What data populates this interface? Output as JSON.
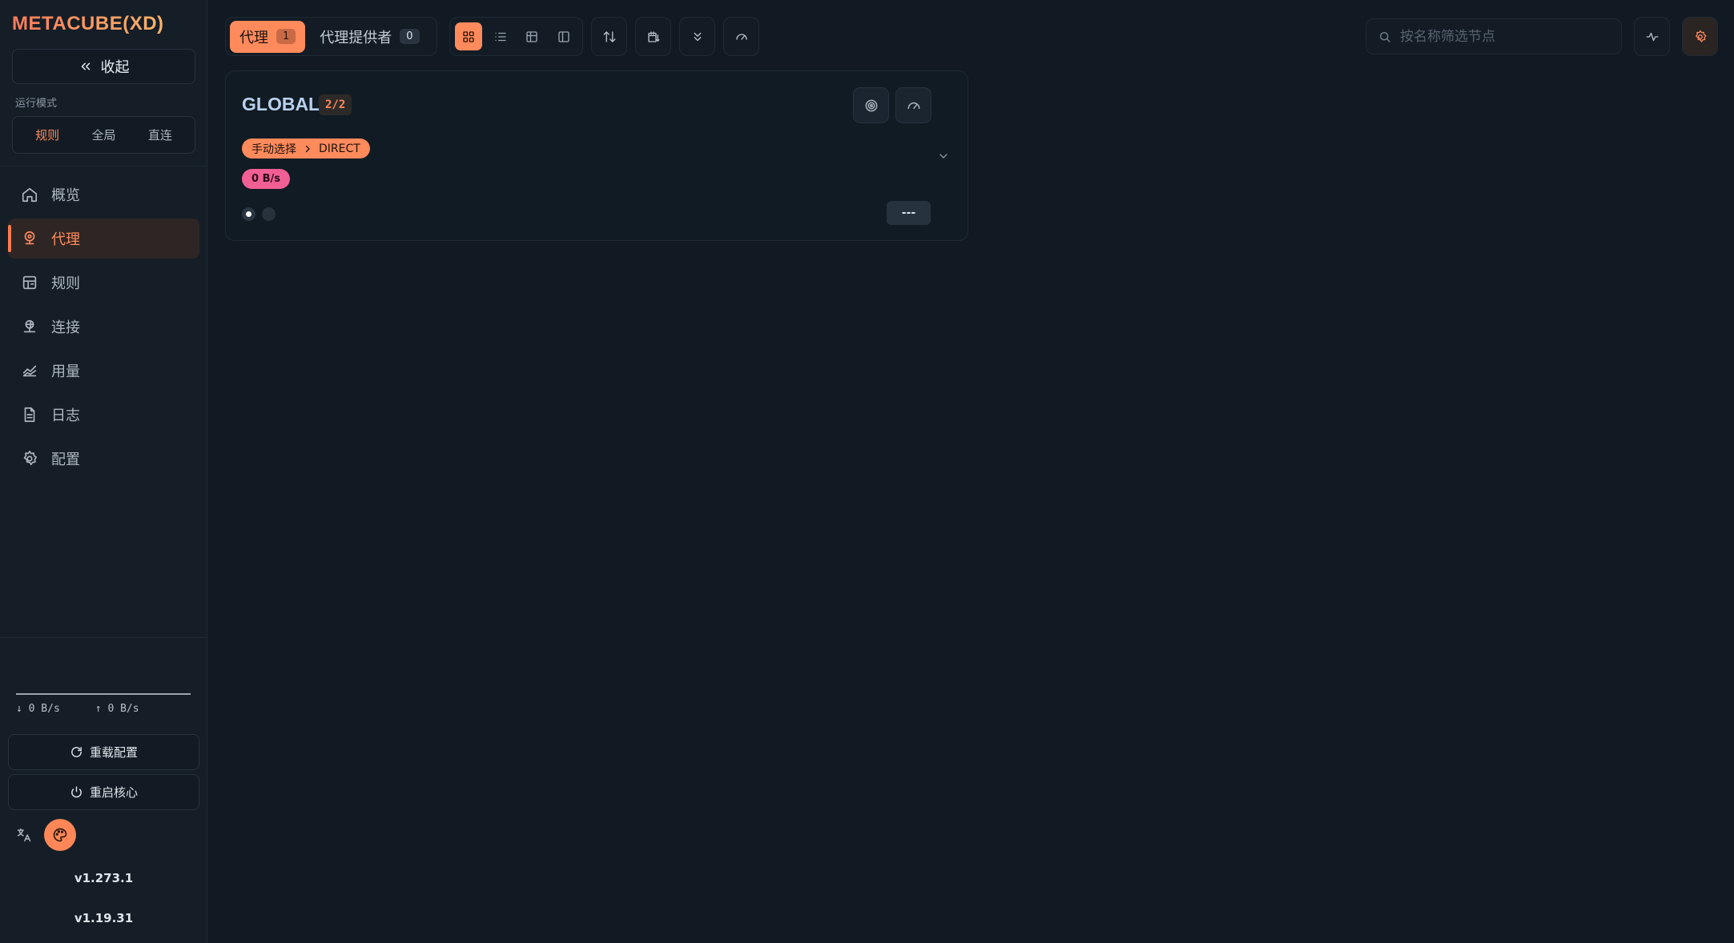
{
  "brand": "METACUBE(XD)",
  "sidebar": {
    "collapse_label": "收起",
    "mode_label": "运行模式",
    "modes": [
      {
        "label": "规则",
        "active": true
      },
      {
        "label": "全局",
        "active": false
      },
      {
        "label": "直连",
        "active": false
      }
    ],
    "nav": [
      {
        "label": "概览",
        "icon": "home-icon",
        "active": false
      },
      {
        "label": "代理",
        "icon": "proxy-globe-icon",
        "active": true
      },
      {
        "label": "规则",
        "icon": "rules-icon",
        "active": false
      },
      {
        "label": "连接",
        "icon": "connections-icon",
        "active": false
      },
      {
        "label": "用量",
        "icon": "traffic-chart-icon",
        "active": false
      },
      {
        "label": "日志",
        "icon": "log-file-icon",
        "active": false
      },
      {
        "label": "配置",
        "icon": "gear-icon",
        "active": false
      }
    ],
    "download_speed": "↓ 0 B/s",
    "upload_speed": "↑ 0 B/s",
    "reload_config_label": "重载配置",
    "restart_core_label": "重启核心",
    "versions": [
      "v1.273.1",
      "v1.19.31"
    ]
  },
  "topbar": {
    "tabs": [
      {
        "label": "代理",
        "count": "1",
        "active": true
      },
      {
        "label": "代理提供者",
        "count": "0",
        "active": false
      }
    ],
    "view_modes": [
      "grid-view-icon",
      "list-view-icon",
      "table-view-icon",
      "sidebar-view-icon"
    ],
    "search_placeholder": "按名称筛选节点"
  },
  "proxy_group": {
    "name": "GLOBAL",
    "count": "2/2",
    "selection_type": "手动选择",
    "current": "DIRECT",
    "speed": "0 B/s",
    "latency": "---"
  },
  "colors": {
    "accent": "#ff8a5c",
    "speed_chip": "#f25f94",
    "background": "#111a22",
    "sidebar": "#151e27"
  }
}
